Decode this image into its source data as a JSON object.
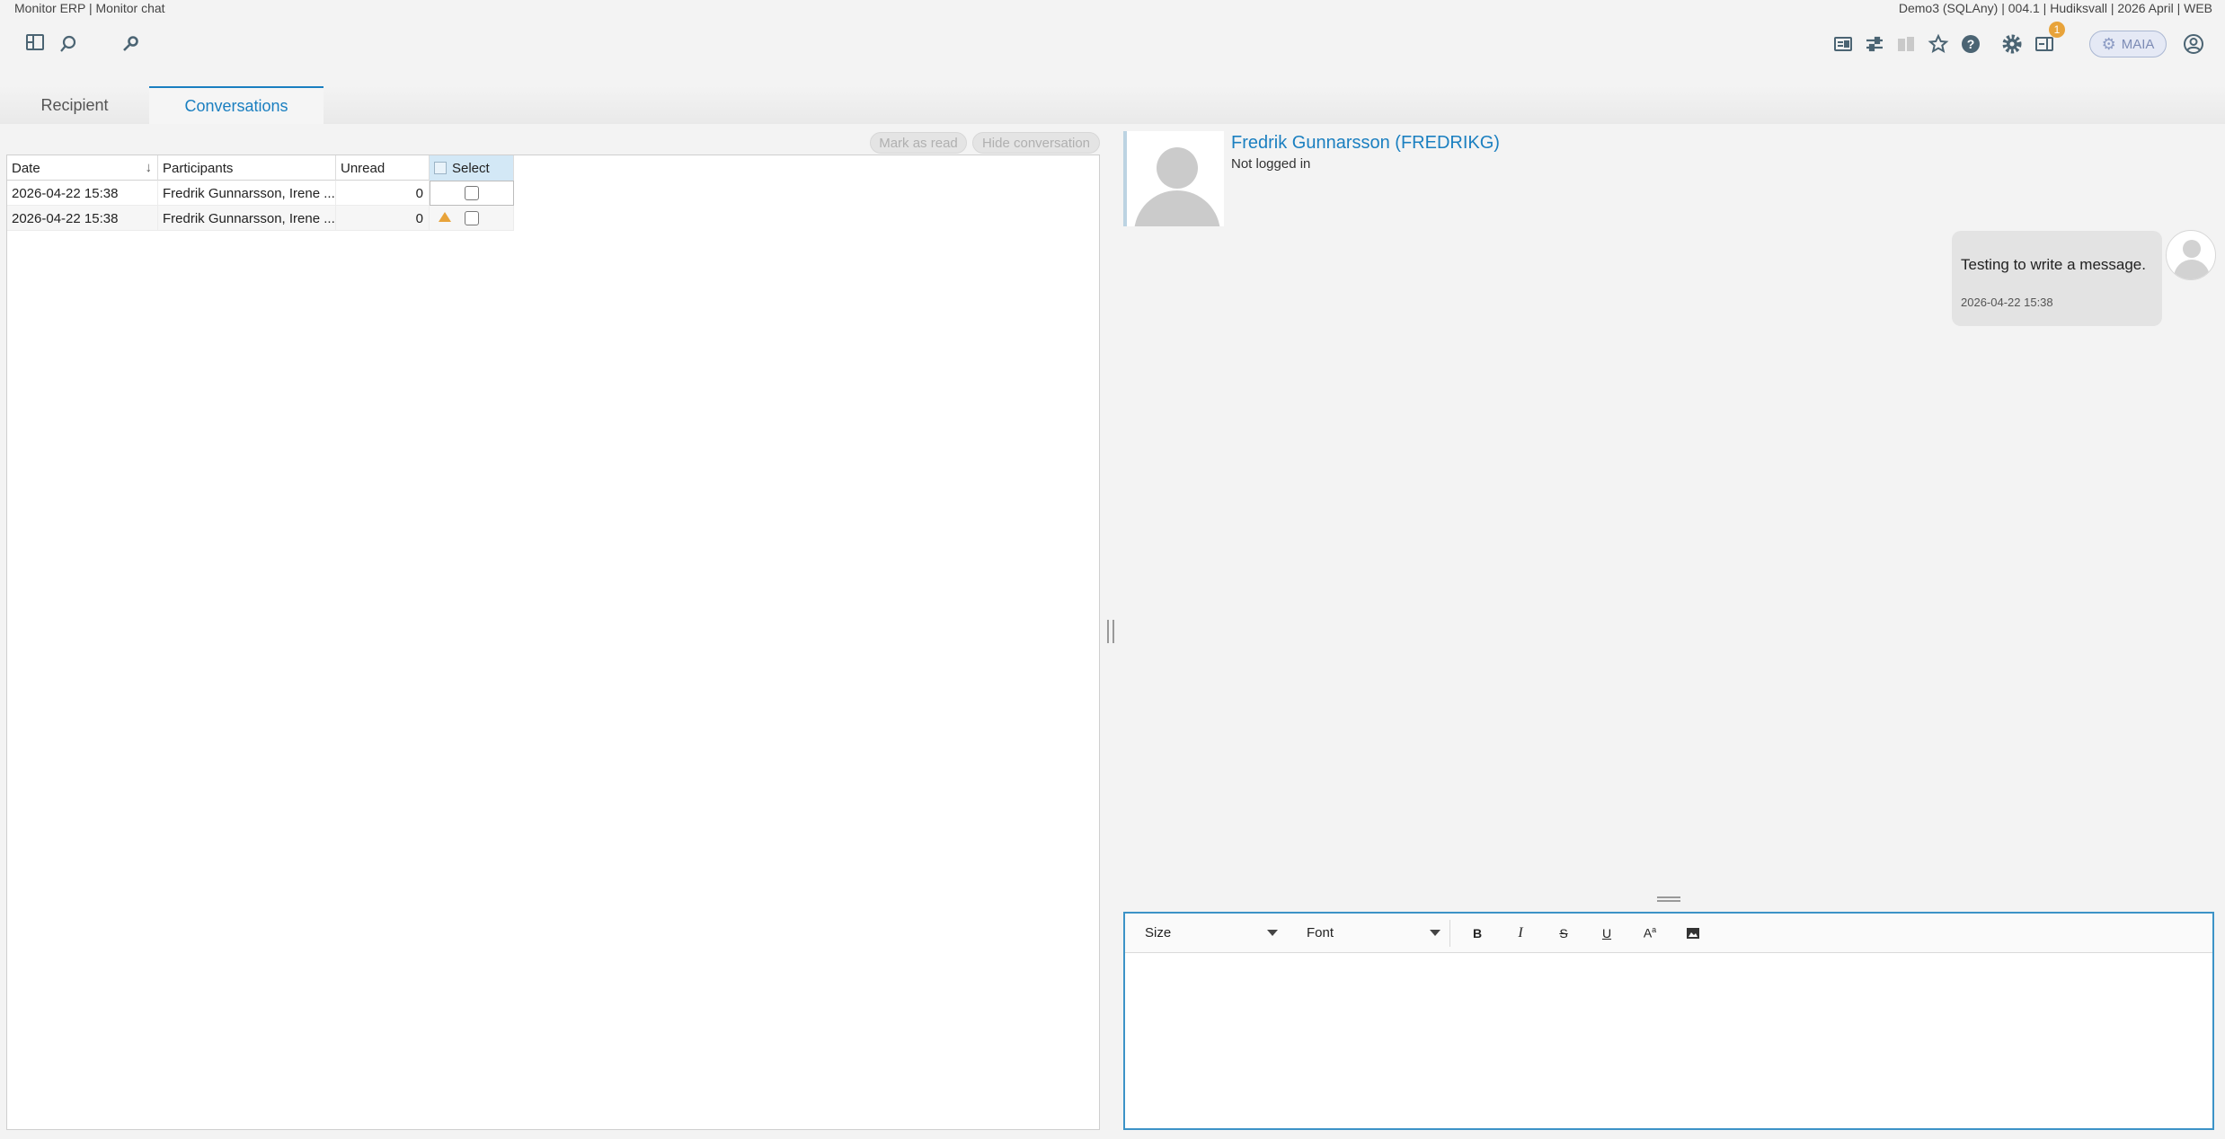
{
  "app": {
    "title": "Monitor ERP | Monitor chat",
    "system_info": "Demo3 (SQLAny) | 004.1 | Hudiksvall | 2026 April | WEB"
  },
  "toolbar": {
    "maia_label": "MAIA",
    "notification_count": "1",
    "icons": [
      "panel-layout-icon",
      "search-icon",
      "tool-search-icon",
      "screen-icon",
      "sliders-icon",
      "layers-icon",
      "star-icon",
      "help-icon",
      "gear-icon",
      "notification-panel-icon",
      "user-account-icon"
    ]
  },
  "tabs": [
    {
      "label": "Recipient",
      "active": false
    },
    {
      "label": "Conversations",
      "active": true
    }
  ],
  "actions": {
    "mark_as_read": "Mark as read",
    "hide_conversation": "Hide conversation"
  },
  "grid": {
    "columns": [
      "Date",
      "Participants",
      "Unread",
      "Select"
    ],
    "rows": [
      {
        "date": "2026-04-22 15:38",
        "participants": "Fredrik Gunnarsson, Irene ...",
        "unread": "0",
        "warning": false,
        "selected": false
      },
      {
        "date": "2026-04-22 15:38",
        "participants": "Fredrik Gunnarsson, Irene ...",
        "unread": "0",
        "warning": true,
        "selected": false
      }
    ]
  },
  "chat": {
    "contact_name": "Fredrik Gunnarsson (FREDRIKG)",
    "contact_status": "Not logged in",
    "messages": [
      {
        "text": "Testing to write a message.",
        "time": "2026-04-22 15:38"
      }
    ]
  },
  "editor": {
    "size_label": "Size",
    "font_label": "Font",
    "format_buttons": [
      "B",
      "I",
      "S",
      "U",
      "A",
      "image"
    ]
  },
  "colors": {
    "accent": "#1a7fc0",
    "warning": "#e8a33a",
    "background": "#f3f3f3"
  }
}
